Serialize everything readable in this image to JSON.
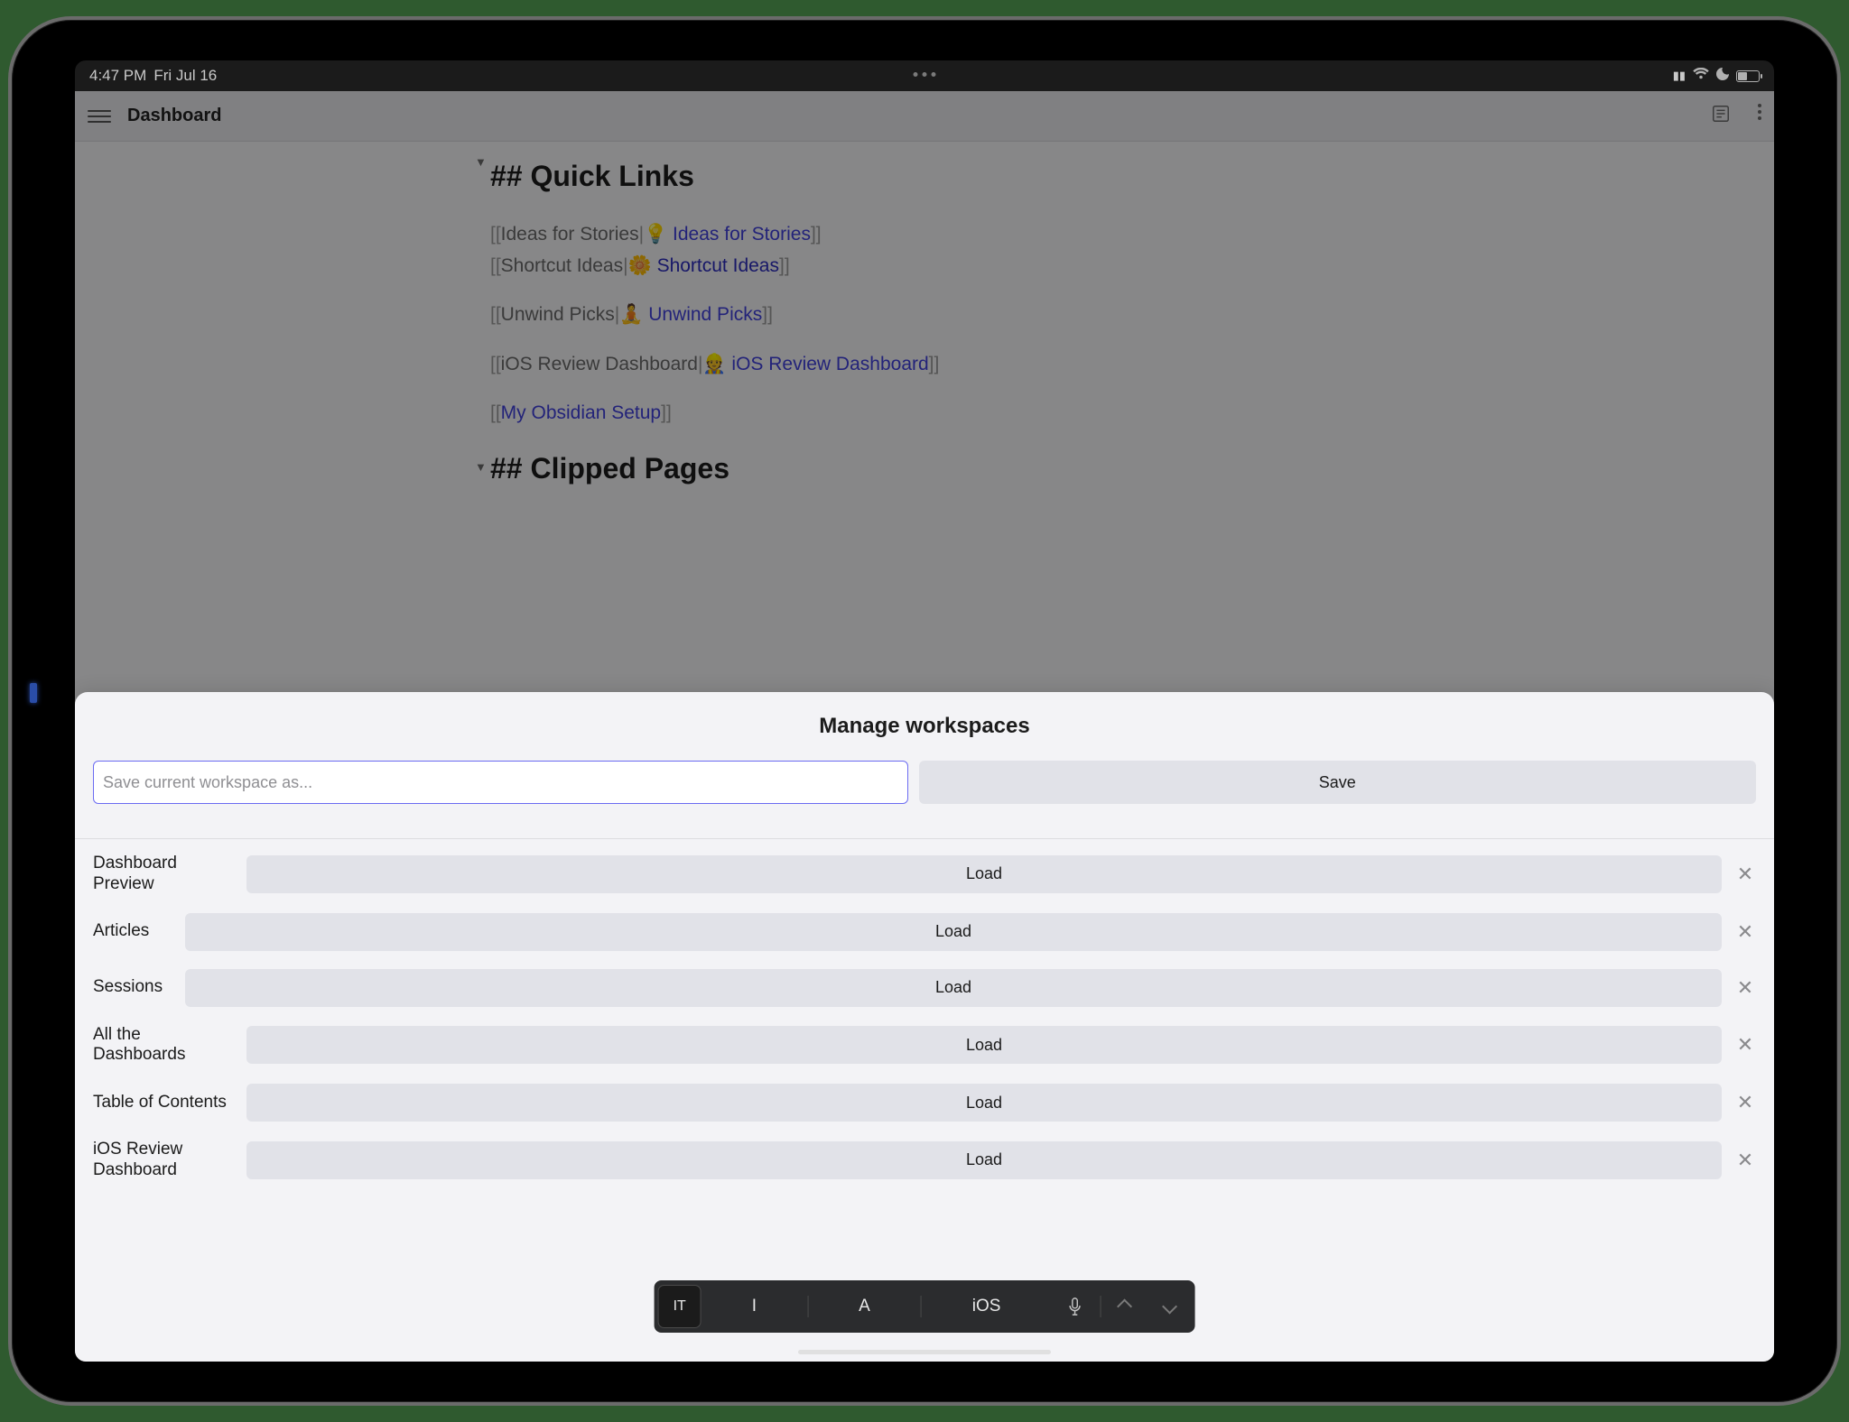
{
  "status": {
    "time": "4:47 PM",
    "date": "Fri Jul 16"
  },
  "bg": {
    "title": "Dashboard",
    "section1": "## Quick Links",
    "section2": "## Clipped Pages",
    "links": {
      "l1_page": "Ideas for Stories",
      "l1_emoji": "💡",
      "l1_label": "Ideas for Stories",
      "l2_page": "Shortcut Ideas",
      "l2_emoji": "🌼",
      "l2_label": "Shortcut Ideas",
      "l3_page": "Unwind Picks",
      "l3_emoji": "🧘",
      "l3_label": "Unwind Picks",
      "l4_page": "iOS Review Dashboard",
      "l4_emoji": "👷",
      "l4_label": "iOS Review Dashboard",
      "l5_page": "My Obsidian Setup"
    }
  },
  "modal": {
    "title": "Manage workspaces",
    "placeholder": "Save current workspace as...",
    "save": "Save",
    "load": "Load",
    "items": [
      "Dashboard Preview",
      "Articles",
      "Sessions",
      "All the Dashboards",
      "Table of Contents",
      "iOS Review Dashboard"
    ]
  },
  "kbd": {
    "lang": "IT",
    "s1": "I",
    "s2": "A",
    "s3": "iOS"
  }
}
